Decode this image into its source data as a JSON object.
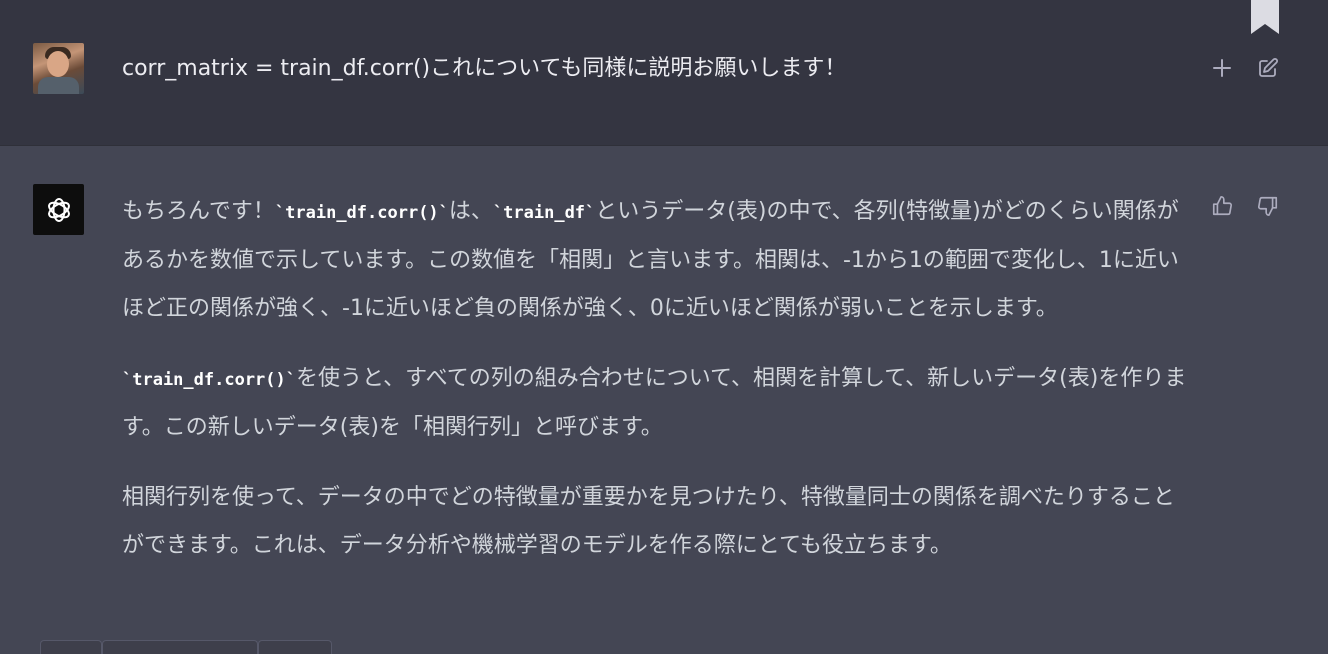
{
  "user_message": {
    "text": "corr_matrix = train_df.corr()これについても同様に説明お願いします！"
  },
  "assistant_message": {
    "paragraphs": [
      {
        "p1a": "もちろんです！",
        "code1": "`train_df.corr()`",
        "p1b": "は、",
        "code2": "`train_df`",
        "p1c": "というデータ(表)の中で、各列(特徴量)がどのくらい関係があるかを数値で示しています。この数値を「相関」と言います。相関は、-1から1の範囲で変化し、1に近いほど正の関係が強く、-1に近いほど負の関係が強く、0に近いほど関係が弱いことを示します。"
      },
      {
        "code1": "`train_df.corr()`",
        "p2a": "を使うと、すべての列の組み合わせについて、相関を計算して、新しいデータ(表)を作ります。この新しいデータ(表)を「相関行列」と呼びます。"
      },
      {
        "p3": "相関行列を使って、データの中でどの特徴量が重要かを見つけたり、特徴量同士の関係を調べたりすることができます。これは、データ分析や機械学習のモデルを作る際にとても役立ちます。"
      }
    ]
  },
  "icons": {
    "plus": "plus-icon",
    "edit": "edit-icon",
    "thumbs_up": "thumbs-up-icon",
    "thumbs_down": "thumbs-down-icon",
    "assistant_logo": "openai-logo-icon",
    "bookmark": "bookmark-icon"
  },
  "colors": {
    "user_bg": "#343541",
    "assistant_bg": "#444654",
    "text": "#d1d5db"
  }
}
